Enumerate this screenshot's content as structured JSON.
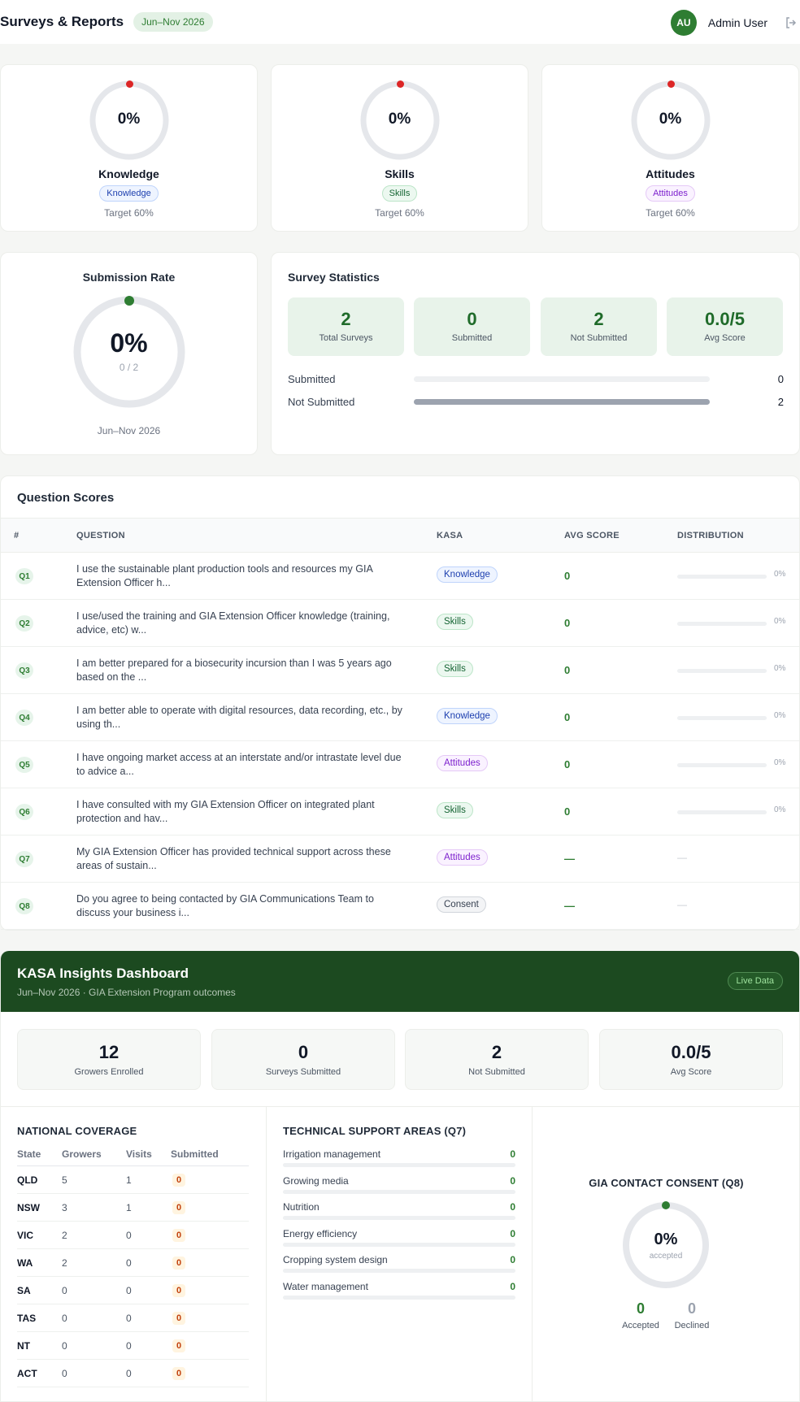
{
  "header": {
    "title": "Surveys & Reports",
    "date_range": "Jun–Nov 2026",
    "user_initials": "AU",
    "user_name": "Admin User",
    "logout_icon": "logout-icon"
  },
  "kasa_cards": [
    {
      "name": "Knowledge",
      "pct": "0%",
      "pill": "Knowledge",
      "target": "Target 60%",
      "value": 0
    },
    {
      "name": "Skills",
      "pct": "0%",
      "pill": "Skills",
      "target": "Target 60%",
      "value": 0
    },
    {
      "name": "Attitudes",
      "pct": "0%",
      "pill": "Attitudes",
      "target": "Target 60%",
      "value": 0
    }
  ],
  "submission": {
    "title": "Submission Rate",
    "pct": "0%",
    "fraction": "0 / 2",
    "range": "Jun–Nov 2026"
  },
  "survey_stats": {
    "title": "Survey Statistics",
    "boxes": [
      {
        "value": "2",
        "label": "Total Surveys"
      },
      {
        "value": "0",
        "label": "Submitted"
      },
      {
        "value": "2",
        "label": "Not Submitted"
      },
      {
        "value": "0.0/5",
        "label": "Avg Score"
      }
    ],
    "bars": [
      {
        "label": "Submitted",
        "count": "0",
        "fraction": 0
      },
      {
        "label": "Not Submitted",
        "count": "2",
        "fraction": 1
      }
    ]
  },
  "question_scores": {
    "title": "Question Scores",
    "columns": [
      "#",
      "QUESTION",
      "KASA",
      "AVG SCORE",
      "DISTRIBUTION"
    ],
    "rows": [
      {
        "num": "Q1",
        "text": "I use the sustainable plant production tools and resources my GIA Extension Officer h...",
        "kasa": "Knowledge",
        "avg": "0",
        "dist": "0%"
      },
      {
        "num": "Q2",
        "text": "I use/used the training and GIA Extension Officer knowledge (training, advice, etc) w...",
        "kasa": "Skills",
        "avg": "0",
        "dist": "0%"
      },
      {
        "num": "Q3",
        "text": "I am better prepared for a biosecurity incursion than I was 5 years ago based on the ...",
        "kasa": "Skills",
        "avg": "0",
        "dist": "0%"
      },
      {
        "num": "Q4",
        "text": "I am better able to operate with digital resources, data recording, etc., by using th...",
        "kasa": "Knowledge",
        "avg": "0",
        "dist": "0%"
      },
      {
        "num": "Q5",
        "text": "I have ongoing market access at an interstate and/or intrastate level due to advice a...",
        "kasa": "Attitudes",
        "avg": "0",
        "dist": "0%"
      },
      {
        "num": "Q6",
        "text": "I have consulted with my GIA Extension Officer on integrated plant protection and hav...",
        "kasa": "Skills",
        "avg": "0",
        "dist": "0%"
      },
      {
        "num": "Q7",
        "text": "My GIA Extension Officer has provided technical support across these areas of sustain...",
        "kasa": "Attitudes",
        "avg": "—",
        "dist": "—"
      },
      {
        "num": "Q8",
        "text": "Do you agree to being contacted by GIA Communications Team to discuss your business i...",
        "kasa": "Consent",
        "avg": "—",
        "dist": "—"
      }
    ]
  },
  "kasa_dashboard": {
    "title": "KASA Insights Dashboard",
    "subtitle": "Jun–Nov 2026 · GIA Extension Program outcomes",
    "live": "Live Data",
    "stats": [
      {
        "value": "12",
        "label": "Growers Enrolled"
      },
      {
        "value": "0",
        "label": "Surveys Submitted"
      },
      {
        "value": "2",
        "label": "Not Submitted"
      },
      {
        "value": "0.0/5",
        "label": "Avg Score"
      }
    ],
    "national": {
      "title": "NATIONAL COVERAGE",
      "columns": [
        "State",
        "Growers",
        "Visits",
        "Submitted"
      ],
      "rows": [
        {
          "state": "QLD",
          "growers": "5",
          "visits": "1",
          "submitted": "0"
        },
        {
          "state": "NSW",
          "growers": "3",
          "visits": "1",
          "submitted": "0"
        },
        {
          "state": "VIC",
          "growers": "2",
          "visits": "0",
          "submitted": "0"
        },
        {
          "state": "WA",
          "growers": "2",
          "visits": "0",
          "submitted": "0"
        },
        {
          "state": "SA",
          "growers": "0",
          "visits": "0",
          "submitted": "0"
        },
        {
          "state": "TAS",
          "growers": "0",
          "visits": "0",
          "submitted": "0"
        },
        {
          "state": "NT",
          "growers": "0",
          "visits": "0",
          "submitted": "0"
        },
        {
          "state": "ACT",
          "growers": "0",
          "visits": "0",
          "submitted": "0"
        }
      ]
    },
    "technical": {
      "title": "TECHNICAL SUPPORT AREAS (Q7)",
      "rows": [
        {
          "name": "Irrigation management",
          "count": "0"
        },
        {
          "name": "Growing media",
          "count": "0"
        },
        {
          "name": "Nutrition",
          "count": "0"
        },
        {
          "name": "Energy efficiency",
          "count": "0"
        },
        {
          "name": "Cropping system design",
          "count": "0"
        },
        {
          "name": "Water management",
          "count": "0"
        }
      ]
    },
    "consent": {
      "title": "GIA CONTACT CONSENT (Q8)",
      "pct": "0%",
      "pct_label": "accepted",
      "accepted_value": "0",
      "accepted_label": "Accepted",
      "declined_value": "0",
      "declined_label": "Declined"
    }
  },
  "colors": {
    "brand_green": "#2e7d32",
    "dark_green": "#1c4a20",
    "ring_gray": "#e5e7eb",
    "alert_red": "#dc2626"
  }
}
